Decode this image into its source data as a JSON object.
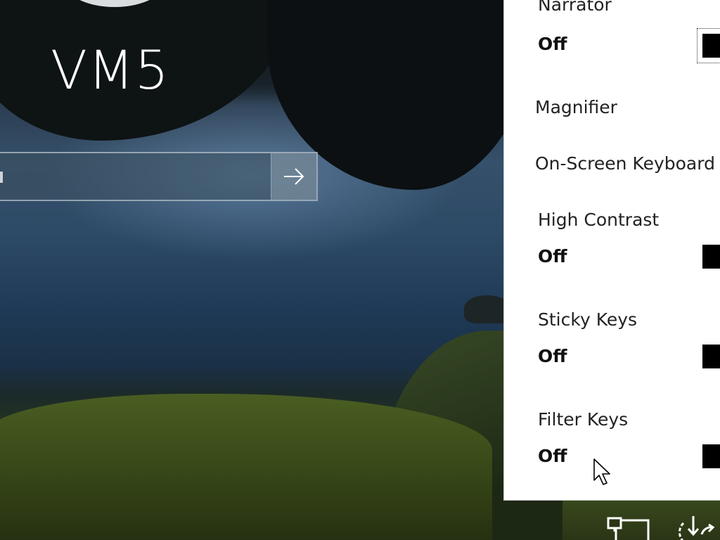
{
  "login": {
    "user_name": "VM5",
    "password_placeholder": "",
    "submit_label": "→"
  },
  "ease_of_access": {
    "narrator": {
      "label": "Narrator",
      "state": "Off"
    },
    "magnifier": {
      "label": "Magnifier"
    },
    "on_screen_keyboard": {
      "label": "On-Screen Keyboard"
    },
    "high_contrast": {
      "label": "High Contrast",
      "state": "Off"
    },
    "sticky_keys": {
      "label": "Sticky Keys",
      "state": "Off"
    },
    "filter_keys": {
      "label": "Filter Keys",
      "state": "Off"
    }
  },
  "taskbar_icons": [
    "network-icon",
    "ease-of-access-power-icon"
  ],
  "colors": {
    "panel_background": "#ffffff",
    "toggle_off": "#000000",
    "text_white": "#ffffff"
  }
}
